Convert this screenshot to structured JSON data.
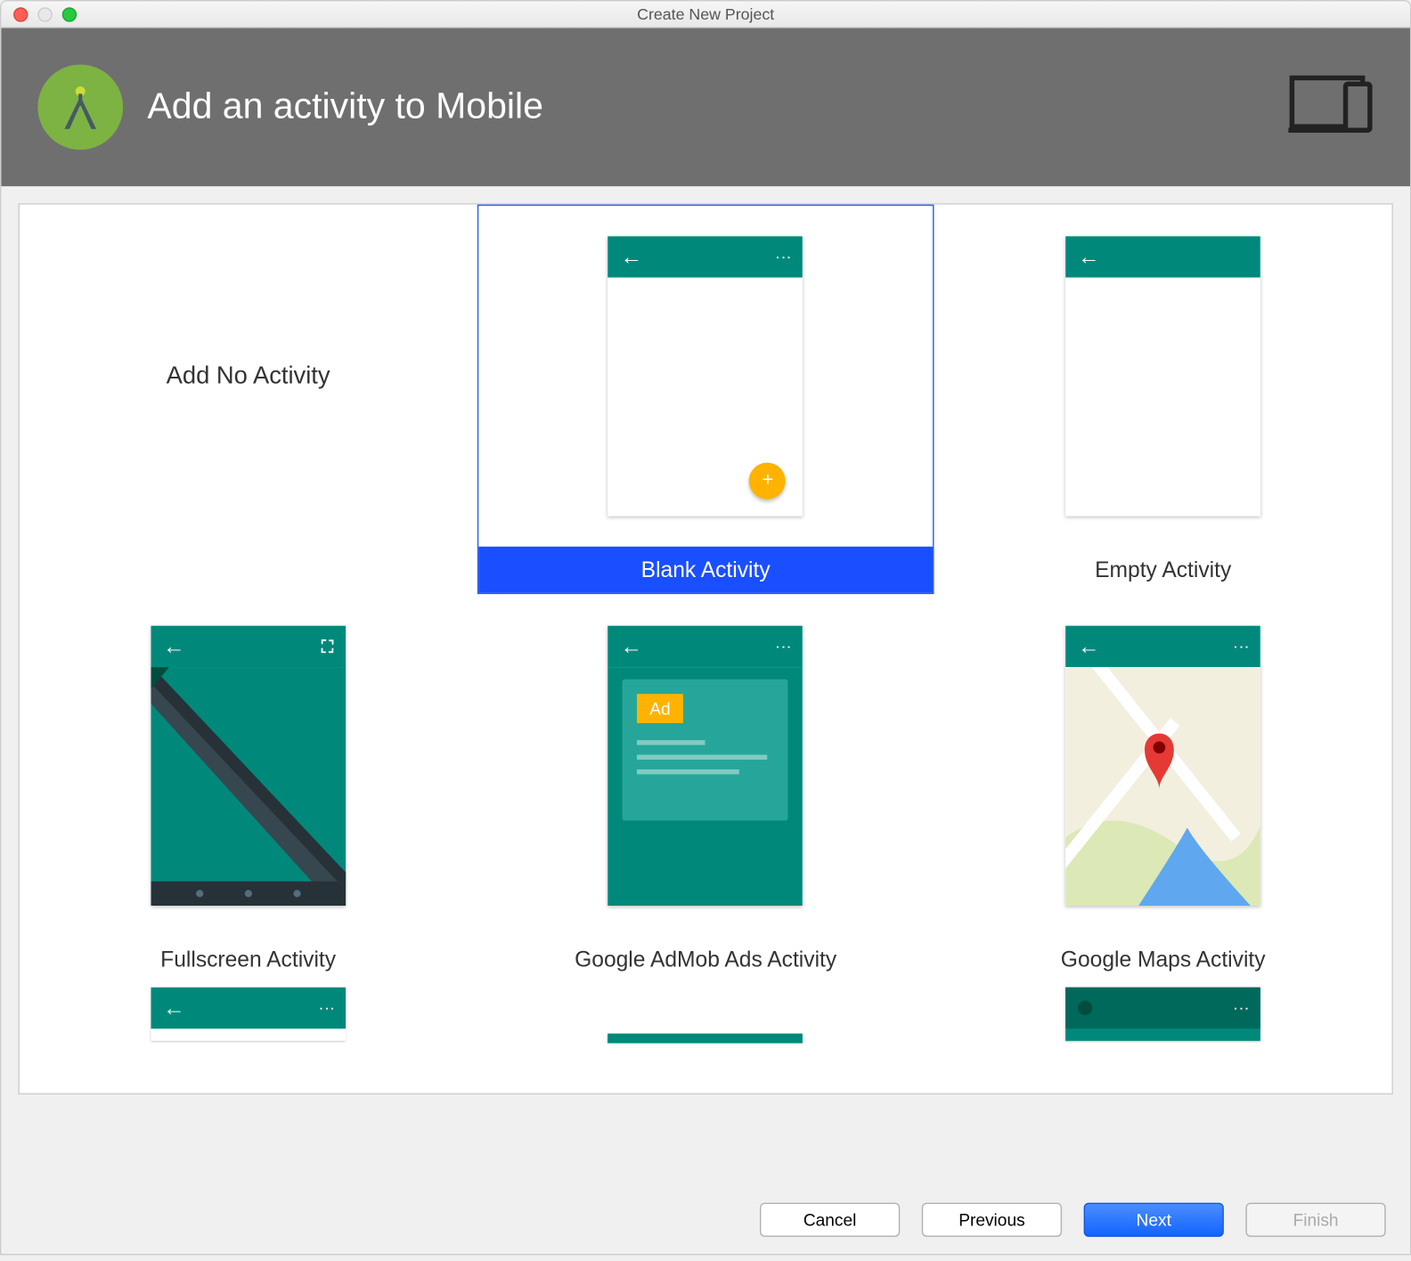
{
  "window": {
    "title": "Create New Project"
  },
  "header": {
    "title": "Add an activity to Mobile"
  },
  "activities": [
    {
      "label": "Add No Activity"
    },
    {
      "label": "Blank Activity"
    },
    {
      "label": "Empty Activity"
    },
    {
      "label": "Fullscreen Activity"
    },
    {
      "label": "Google AdMob Ads Activity"
    },
    {
      "label": "Google Maps Activity"
    }
  ],
  "ad_badge": "Ad",
  "fab_glyph": "+",
  "footer": {
    "cancel": "Cancel",
    "previous": "Previous",
    "next": "Next",
    "finish": "Finish"
  },
  "colors": {
    "teal": "#00897b",
    "accent_orange": "#ffb300",
    "selection_blue": "#1a4fff",
    "header_gray": "#6f6f6f",
    "logo_green": "#7cb342"
  }
}
